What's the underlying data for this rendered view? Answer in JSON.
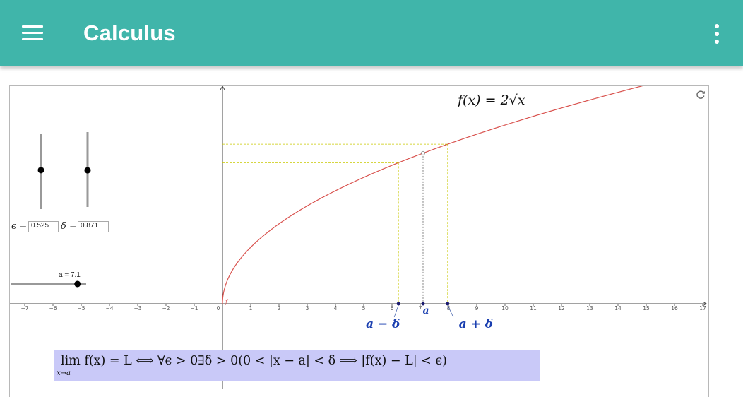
{
  "app": {
    "title": "Calculus",
    "accent_color": "#40b5aa"
  },
  "toolbar": {
    "menu_icon": "hamburger-menu-icon",
    "more_icon": "more-vertical-icon"
  },
  "graph": {
    "function_label": "f(x) = 2√x",
    "refresh_icon": "refresh-icon",
    "curve_color": "#d9534f",
    "guide_color": "#c8c800",
    "x_ticks": [
      "−7",
      "−6",
      "−5",
      "−4",
      "−3",
      "−2",
      "−1",
      "0",
      "1",
      "2",
      "3",
      "4",
      "5",
      "6",
      "7",
      "8",
      "9",
      "10",
      "11",
      "12",
      "13",
      "14",
      "15",
      "16",
      "17"
    ],
    "point_labels": {
      "a": "a",
      "a_minus_delta": "a − δ",
      "a_plus_delta": "a + δ"
    },
    "origin_marker": "f"
  },
  "controls": {
    "epsilon": {
      "label": "ϵ =",
      "value": "0.525",
      "level": 0.525
    },
    "delta": {
      "label": "δ =",
      "value": "0.871",
      "level": 0.871
    },
    "a_slider": {
      "label": "a = 7.1",
      "value": 7.1
    }
  },
  "formula": {
    "text": "lim f(x) = L  ⟺  ∀ϵ > 0∃δ > 0(0 < |x − a| < δ  ⟹  |f(x) − L| < ϵ)",
    "subscript": "x→a"
  }
}
